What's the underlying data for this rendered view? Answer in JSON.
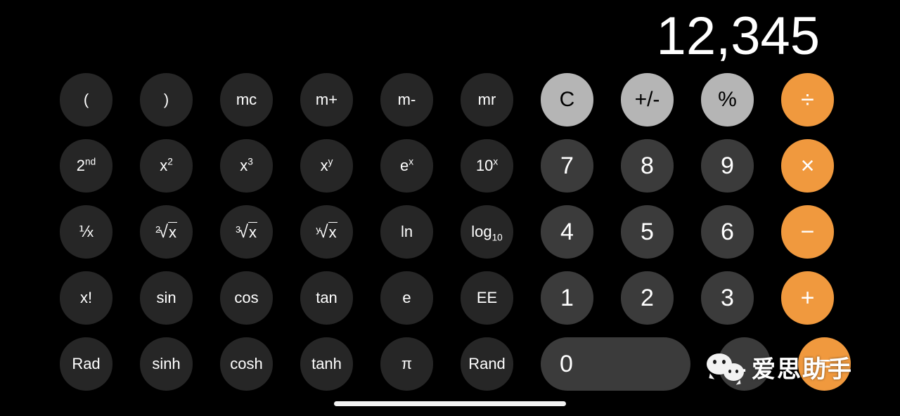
{
  "app": {
    "name": "Calculator",
    "mode": "scientific"
  },
  "display": {
    "value": "12,345"
  },
  "colors": {
    "background": "#000000",
    "function_key": "#262626",
    "digit_key": "#3b3b3b",
    "clear_key": "#b5b5b5",
    "operator_key": "#f0993e",
    "text": "#ffffff",
    "clear_key_text": "#000000"
  },
  "keypad": {
    "rows": [
      [
        {
          "label": "(",
          "name": "key-open-paren",
          "style": "fn"
        },
        {
          "label": ")",
          "name": "key-close-paren",
          "style": "fn"
        },
        {
          "label": "mc",
          "name": "key-memory-clear",
          "style": "fn"
        },
        {
          "label": "m+",
          "name": "key-memory-add",
          "style": "fn"
        },
        {
          "label": "m-",
          "name": "key-memory-subtract",
          "style": "fn"
        },
        {
          "label": "mr",
          "name": "key-memory-recall",
          "style": "fn"
        },
        {
          "label": "C",
          "name": "key-clear",
          "style": "top-gray"
        },
        {
          "label": "+/-",
          "name": "key-sign-toggle",
          "style": "top-gray"
        },
        {
          "label": "%",
          "name": "key-percent",
          "style": "top-gray"
        },
        {
          "label": "÷",
          "name": "key-divide",
          "style": "op"
        }
      ],
      [
        {
          "label": "2nd",
          "name": "key-second-function",
          "style": "fn",
          "glyph": "sup",
          "base": "2",
          "exp": "nd"
        },
        {
          "label": "x²",
          "name": "key-square",
          "style": "fn",
          "glyph": "sup",
          "base": "x",
          "exp": "2"
        },
        {
          "label": "x³",
          "name": "key-cube",
          "style": "fn",
          "glyph": "sup",
          "base": "x",
          "exp": "3"
        },
        {
          "label": "xʸ",
          "name": "key-power-y",
          "style": "fn",
          "glyph": "sup",
          "base": "x",
          "exp": "y"
        },
        {
          "label": "eˣ",
          "name": "key-exp-e",
          "style": "fn",
          "glyph": "sup",
          "base": "e",
          "exp": "x"
        },
        {
          "label": "10ˣ",
          "name": "key-exp-ten",
          "style": "fn",
          "glyph": "sup",
          "base": "10",
          "exp": "x"
        },
        {
          "label": "7",
          "name": "key-digit-7",
          "style": "digit"
        },
        {
          "label": "8",
          "name": "key-digit-8",
          "style": "digit"
        },
        {
          "label": "9",
          "name": "key-digit-9",
          "style": "digit"
        },
        {
          "label": "×",
          "name": "key-multiply",
          "style": "op"
        }
      ],
      [
        {
          "label": "1/x",
          "name": "key-reciprocal",
          "style": "fn",
          "glyph": "frac",
          "base": "⅟",
          "exp": "x"
        },
        {
          "label": "2√x",
          "name": "key-square-root",
          "style": "fn",
          "glyph": "radical",
          "index": "2"
        },
        {
          "label": "3√x",
          "name": "key-cube-root",
          "style": "fn",
          "glyph": "radical",
          "index": "3"
        },
        {
          "label": "y√x",
          "name": "key-nth-root",
          "style": "fn",
          "glyph": "radical",
          "index": "y"
        },
        {
          "label": "ln",
          "name": "key-natural-log",
          "style": "fn"
        },
        {
          "label": "log10",
          "name": "key-log-base-10",
          "style": "fn",
          "glyph": "sub",
          "base": "log",
          "exp": "10"
        },
        {
          "label": "4",
          "name": "key-digit-4",
          "style": "digit"
        },
        {
          "label": "5",
          "name": "key-digit-5",
          "style": "digit"
        },
        {
          "label": "6",
          "name": "key-digit-6",
          "style": "digit"
        },
        {
          "label": "−",
          "name": "key-subtract",
          "style": "op"
        }
      ],
      [
        {
          "label": "x!",
          "name": "key-factorial",
          "style": "fn"
        },
        {
          "label": "sin",
          "name": "key-sine",
          "style": "fn"
        },
        {
          "label": "cos",
          "name": "key-cosine",
          "style": "fn"
        },
        {
          "label": "tan",
          "name": "key-tangent",
          "style": "fn"
        },
        {
          "label": "e",
          "name": "key-euler-number",
          "style": "fn"
        },
        {
          "label": "EE",
          "name": "key-scientific-notation",
          "style": "fn"
        },
        {
          "label": "1",
          "name": "key-digit-1",
          "style": "digit"
        },
        {
          "label": "2",
          "name": "key-digit-2",
          "style": "digit"
        },
        {
          "label": "3",
          "name": "key-digit-3",
          "style": "digit"
        },
        {
          "label": "+",
          "name": "key-add",
          "style": "op"
        }
      ],
      [
        {
          "label": "Rad",
          "name": "key-radian-mode",
          "style": "fn"
        },
        {
          "label": "sinh",
          "name": "key-hyperbolic-sine",
          "style": "fn"
        },
        {
          "label": "cosh",
          "name": "key-hyperbolic-cosine",
          "style": "fn"
        },
        {
          "label": "tanh",
          "name": "key-hyperbolic-tangent",
          "style": "fn"
        },
        {
          "label": "π",
          "name": "key-pi",
          "style": "fn"
        },
        {
          "label": "Rand",
          "name": "key-random",
          "style": "fn"
        },
        {
          "label": "0",
          "name": "key-digit-0",
          "style": "digit zero"
        },
        {
          "label": ".",
          "name": "key-decimal-point",
          "style": "digit"
        },
        {
          "label": "=",
          "name": "key-equals",
          "style": "op"
        }
      ]
    ]
  },
  "watermark": {
    "logo": "wechat-logo",
    "text": "爱思助手"
  }
}
